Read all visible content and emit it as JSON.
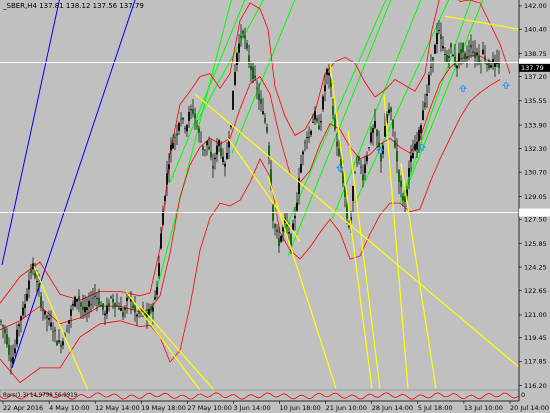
{
  "window": {
    "title": "_SBER,H4  137.81 138.12 137.56 137.79"
  },
  "indicator": {
    "label": "Bars(1,3) 14.9798 56.9919"
  },
  "colors": {
    "background": "#c0c0c0",
    "up_body": "#000000",
    "down_body": "#006400",
    "wick": "#000000",
    "bands": "#ff0000",
    "trend_yellow": "#ffff00",
    "trend_green": "#00ff00",
    "trend_blue": "#0000ff",
    "hline": "#ffffff",
    "arrow": "#1e90ff"
  },
  "chart_data": {
    "type": "candlestick",
    "symbol": "_SBER",
    "timeframe": "H4",
    "ohlc_header": {
      "open": 137.81,
      "high": 138.12,
      "low": 137.56,
      "close": 137.79
    },
    "y_ticks": [
      142.0,
      140.4,
      138.75,
      137.2,
      135.55,
      133.9,
      132.3,
      130.7,
      129.05,
      127.5,
      125.85,
      124.25,
      122.65,
      121.0,
      119.45,
      117.85,
      116.2
    ],
    "y_range": [
      115.9,
      142.4
    ],
    "x_ticks": [
      "22 Apr 2016",
      "4 May 10:00",
      "12 May 14:00",
      "19 May 18:00",
      "27 May 10:00",
      "3 Jun 14:00",
      "10 Jun 18:00",
      "21 Jun 10:00",
      "28 Jun 14:00",
      "5 Jul 18:00",
      "13 Jul 10:00",
      "20 Jul 14:00"
    ],
    "current_price_badge": "137.79",
    "hline_badges": [
      "138.15",
      "127.96"
    ],
    "bottom_badge": "0",
    "horizontal_lines": [
      138.15,
      127.96
    ],
    "price_path": [
      [
        0,
        120.6
      ],
      [
        3,
        120.2
      ],
      [
        6,
        119.6
      ],
      [
        9,
        118.5
      ],
      [
        12,
        117.9
      ],
      [
        15,
        118.7
      ],
      [
        18,
        120.2
      ],
      [
        21,
        121.0
      ],
      [
        24,
        121.4
      ],
      [
        27,
        122.6
      ],
      [
        30,
        123.8
      ],
      [
        33,
        124.3
      ],
      [
        36,
        123.4
      ],
      [
        39,
        122.6
      ],
      [
        42,
        121.5
      ],
      [
        45,
        121.0
      ],
      [
        48,
        120.7
      ],
      [
        51,
        120.3
      ],
      [
        54,
        119.9
      ],
      [
        57,
        119.2
      ],
      [
        60,
        119.0
      ],
      [
        63,
        119.3
      ],
      [
        66,
        119.9
      ],
      [
        69,
        120.7
      ],
      [
        72,
        121.5
      ],
      [
        75,
        122.0
      ],
      [
        78,
        122.3
      ],
      [
        81,
        121.6
      ],
      [
        84,
        121.2
      ],
      [
        87,
        121.4
      ],
      [
        90,
        121.8
      ],
      [
        93,
        122.2
      ],
      [
        96,
        122.4
      ],
      [
        99,
        121.9
      ],
      [
        102,
        121.5
      ],
      [
        105,
        121.0
      ],
      [
        108,
        121.6
      ],
      [
        111,
        122.2
      ],
      [
        114,
        121.9
      ],
      [
        117,
        121.6
      ],
      [
        120,
        121.5
      ],
      [
        123,
        121.0
      ],
      [
        126,
        121.7
      ],
      [
        129,
        122.3
      ],
      [
        132,
        121.8
      ],
      [
        135,
        121.1
      ],
      [
        138,
        120.9
      ],
      [
        141,
        121.3
      ],
      [
        144,
        121.1
      ],
      [
        147,
        120.9
      ],
      [
        150,
        121.3
      ],
      [
        153,
        121.6
      ],
      [
        156,
        122.4
      ],
      [
        159,
        124.5
      ],
      [
        162,
        127.4
      ],
      [
        165,
        129.3
      ],
      [
        168,
        131.1
      ],
      [
        171,
        132.4
      ],
      [
        174,
        133.0
      ],
      [
        177,
        133.4
      ],
      [
        180,
        134.6
      ],
      [
        183,
        134.1
      ],
      [
        186,
        133.7
      ],
      [
        189,
        134.6
      ],
      [
        192,
        135.0
      ],
      [
        195,
        134.4
      ],
      [
        198,
        133.5
      ],
      [
        201,
        132.8
      ],
      [
        204,
        132.1
      ],
      [
        207,
        132.8
      ],
      [
        210,
        131.8
      ],
      [
        213,
        131.0
      ],
      [
        216,
        132.1
      ],
      [
        219,
        132.8
      ],
      [
        222,
        131.7
      ],
      [
        225,
        131.0
      ],
      [
        228,
        132.6
      ],
      [
        231,
        134.2
      ],
      [
        234,
        136.8
      ],
      [
        237,
        138.8
      ],
      [
        240,
        139.7
      ],
      [
        243,
        140.4
      ],
      [
        246,
        139.2
      ],
      [
        249,
        138.2
      ],
      [
        252,
        137.6
      ],
      [
        255,
        136.8
      ],
      [
        258,
        136.0
      ],
      [
        261,
        135.2
      ],
      [
        264,
        134.4
      ],
      [
        267,
        133.6
      ],
      [
        270,
        131.0
      ],
      [
        273,
        127.6
      ],
      [
        276,
        126.6
      ],
      [
        279,
        125.9
      ],
      [
        282,
        126.6
      ],
      [
        285,
        127.4
      ],
      [
        288,
        126.6
      ],
      [
        291,
        126.0
      ],
      [
        294,
        127.4
      ],
      [
        297,
        128.8
      ],
      [
        300,
        130.7
      ],
      [
        303,
        132.3
      ],
      [
        306,
        133.3
      ],
      [
        309,
        133.0
      ],
      [
        312,
        134.1
      ],
      [
        315,
        134.6
      ],
      [
        318,
        133.6
      ],
      [
        321,
        134.4
      ],
      [
        324,
        136.2
      ],
      [
        327,
        137.6
      ],
      [
        330,
        137.0
      ],
      [
        333,
        134.7
      ],
      [
        336,
        133.0
      ],
      [
        339,
        131.7
      ],
      [
        342,
        130.7
      ],
      [
        345,
        129.0
      ],
      [
        348,
        126.9
      ],
      [
        351,
        127.7
      ],
      [
        354,
        130.4
      ],
      [
        357,
        131.6
      ],
      [
        360,
        131.2
      ],
      [
        363,
        130.4
      ],
      [
        366,
        131.6
      ],
      [
        369,
        132.6
      ],
      [
        372,
        133.4
      ],
      [
        375,
        133.9
      ],
      [
        378,
        132.6
      ],
      [
        381,
        131.6
      ],
      [
        384,
        133.1
      ],
      [
        387,
        134.6
      ],
      [
        390,
        135.0
      ],
      [
        393,
        133.6
      ],
      [
        396,
        132.0
      ],
      [
        399,
        130.3
      ],
      [
        402,
        129.1
      ],
      [
        405,
        128.6
      ],
      [
        408,
        130.4
      ],
      [
        411,
        131.6
      ],
      [
        414,
        132.2
      ],
      [
        417,
        132.7
      ],
      [
        420,
        133.6
      ],
      [
        423,
        135.0
      ],
      [
        426,
        135.6
      ],
      [
        429,
        137.1
      ],
      [
        432,
        138.3
      ],
      [
        435,
        139.2
      ],
      [
        438,
        140.4
      ],
      [
        441,
        139.6
      ],
      [
        444,
        138.9
      ],
      [
        447,
        138.2
      ],
      [
        450,
        139.2
      ],
      [
        453,
        138.6
      ],
      [
        456,
        137.9
      ],
      [
        459,
        138.6
      ],
      [
        462,
        139.2
      ],
      [
        465,
        138.2
      ],
      [
        468,
        138.9
      ],
      [
        471,
        139.4
      ],
      [
        474,
        138.6
      ],
      [
        477,
        138.8
      ],
      [
        480,
        138.2
      ],
      [
        483,
        138.9
      ],
      [
        486,
        138.3
      ],
      [
        489,
        137.9
      ],
      [
        492,
        138.3
      ],
      [
        495,
        137.9
      ],
      [
        498,
        138.0
      ],
      [
        500,
        137.9
      ]
    ],
    "bollinger_upper": [
      [
        0,
        121.8
      ],
      [
        20,
        123.6
      ],
      [
        40,
        124.6
      ],
      [
        60,
        122.4
      ],
      [
        80,
        122.0
      ],
      [
        100,
        122.6
      ],
      [
        120,
        122.6
      ],
      [
        140,
        122.3
      ],
      [
        150,
        122.5
      ],
      [
        160,
        125.5
      ],
      [
        170,
        132.0
      ],
      [
        180,
        135.3
      ],
      [
        190,
        136.2
      ],
      [
        200,
        137.2
      ],
      [
        210,
        137.4
      ],
      [
        220,
        136.4
      ],
      [
        230,
        137.4
      ],
      [
        240,
        141.0
      ],
      [
        250,
        142.2
      ],
      [
        260,
        141.8
      ],
      [
        268,
        140.4
      ],
      [
        275,
        136.5
      ],
      [
        285,
        134.5
      ],
      [
        295,
        133.2
      ],
      [
        305,
        133.6
      ],
      [
        315,
        134.8
      ],
      [
        325,
        137.4
      ],
      [
        335,
        138.2
      ],
      [
        345,
        138.5
      ],
      [
        355,
        138.1
      ],
      [
        365,
        136.8
      ],
      [
        375,
        135.8
      ],
      [
        385,
        136.3
      ],
      [
        395,
        137.0
      ],
      [
        405,
        136.6
      ],
      [
        415,
        136.2
      ],
      [
        425,
        137.4
      ],
      [
        432,
        140.4
      ],
      [
        440,
        142.6
      ],
      [
        450,
        143.0
      ],
      [
        460,
        142.3
      ],
      [
        470,
        142.4
      ],
      [
        480,
        142.2
      ],
      [
        490,
        140.8
      ],
      [
        500,
        139.4
      ],
      [
        510,
        137.4
      ]
    ],
    "bollinger_middle": [
      [
        0,
        120.0
      ],
      [
        20,
        120.6
      ],
      [
        40,
        121.6
      ],
      [
        60,
        120.4
      ],
      [
        80,
        120.8
      ],
      [
        100,
        121.6
      ],
      [
        120,
        121.6
      ],
      [
        140,
        121.2
      ],
      [
        150,
        121.4
      ],
      [
        160,
        122.3
      ],
      [
        170,
        125.2
      ],
      [
        180,
        129.0
      ],
      [
        190,
        131.2
      ],
      [
        200,
        132.4
      ],
      [
        210,
        133.0
      ],
      [
        220,
        132.6
      ],
      [
        230,
        133.0
      ],
      [
        240,
        135.0
      ],
      [
        250,
        136.7
      ],
      [
        260,
        137.2
      ],
      [
        270,
        136.0
      ],
      [
        280,
        133.0
      ],
      [
        290,
        130.6
      ],
      [
        300,
        130.0
      ],
      [
        310,
        130.8
      ],
      [
        320,
        132.6
      ],
      [
        330,
        134.0
      ],
      [
        340,
        133.6
      ],
      [
        350,
        132.4
      ],
      [
        360,
        131.6
      ],
      [
        370,
        131.9
      ],
      [
        380,
        132.6
      ],
      [
        390,
        133.0
      ],
      [
        400,
        132.4
      ],
      [
        410,
        132.0
      ],
      [
        420,
        133.0
      ],
      [
        430,
        135.0
      ],
      [
        440,
        136.8
      ],
      [
        450,
        137.8
      ],
      [
        460,
        138.4
      ],
      [
        470,
        138.6
      ],
      [
        480,
        138.6
      ],
      [
        490,
        138.2
      ],
      [
        500,
        138.1
      ]
    ],
    "bollinger_lower": [
      [
        0,
        118.0
      ],
      [
        20,
        116.4
      ],
      [
        40,
        117.4
      ],
      [
        60,
        117.4
      ],
      [
        80,
        119.5
      ],
      [
        100,
        120.4
      ],
      [
        120,
        120.6
      ],
      [
        140,
        120.2
      ],
      [
        150,
        120.3
      ],
      [
        160,
        119.5
      ],
      [
        170,
        117.8
      ],
      [
        180,
        118.6
      ],
      [
        190,
        121.6
      ],
      [
        200,
        125.4
      ],
      [
        210,
        127.6
      ],
      [
        220,
        128.6
      ],
      [
        230,
        128.4
      ],
      [
        240,
        128.8
      ],
      [
        250,
        130.0
      ],
      [
        260,
        131.6
      ],
      [
        270,
        130.4
      ],
      [
        280,
        126.6
      ],
      [
        290,
        125.4
      ],
      [
        300,
        124.8
      ],
      [
        310,
        125.6
      ],
      [
        320,
        126.6
      ],
      [
        330,
        127.5
      ],
      [
        340,
        126.6
      ],
      [
        350,
        124.8
      ],
      [
        360,
        125.0
      ],
      [
        370,
        126.5
      ],
      [
        380,
        127.8
      ],
      [
        390,
        128.6
      ],
      [
        400,
        128.6
      ],
      [
        410,
        128.0
      ],
      [
        420,
        128.2
      ],
      [
        430,
        130.0
      ],
      [
        440,
        131.6
      ],
      [
        450,
        133.0
      ],
      [
        460,
        134.4
      ],
      [
        470,
        135.5
      ],
      [
        480,
        136.1
      ],
      [
        490,
        136.6
      ],
      [
        500,
        137.0
      ]
    ],
    "yellow_lines": [
      [
        [
          34,
          124.3
        ],
        [
          88,
          115.9
        ]
      ],
      [
        [
          126,
          122.6
        ],
        [
          200,
          115.9
        ]
      ],
      [
        [
          140,
          121.6
        ],
        [
          245,
          113.5
        ]
      ],
      [
        [
          195,
          136.0
        ],
        [
          520,
          117.4
        ]
      ],
      [
        [
          228,
          133.0
        ],
        [
          300,
          126.0
        ]
      ],
      [
        [
          268,
          130.4
        ],
        [
          336,
          116.0
        ]
      ],
      [
        [
          330,
          138.0
        ],
        [
          372,
          116.0
        ]
      ],
      [
        [
          348,
          133.5
        ],
        [
          380,
          116.0
        ]
      ],
      [
        [
          384,
          136.0
        ],
        [
          408,
          116.0
        ]
      ],
      [
        [
          401,
          131.3
        ],
        [
          436,
          116.0
        ]
      ],
      [
        [
          445,
          141.3
        ],
        [
          520,
          140.4
        ]
      ]
    ],
    "green_lines": [
      [
        [
          148,
          120.4
        ],
        [
          232,
          142.6
        ]
      ],
      [
        [
          170,
          130.0
        ],
        [
          246,
          142.6
        ]
      ],
      [
        [
          196,
          134.0
        ],
        [
          265,
          142.6
        ]
      ],
      [
        [
          232,
          132.0
        ],
        [
          296,
          142.6
        ]
      ],
      [
        [
          280,
          126.0
        ],
        [
          387,
          142.6
        ]
      ],
      [
        [
          288,
          125.0
        ],
        [
          392,
          142.6
        ]
      ],
      [
        [
          332,
          127.5
        ],
        [
          422,
          142.6
        ]
      ],
      [
        [
          355,
          128.6
        ],
        [
          450,
          142.6
        ]
      ],
      [
        [
          400,
          128.6
        ],
        [
          472,
          142.6
        ]
      ],
      [
        [
          404,
          129.2
        ],
        [
          484,
          142.6
        ]
      ]
    ],
    "blue_lines": [
      [
        [
          2,
          124.4
        ],
        [
          60,
          142.6
        ]
      ],
      [
        [
          12,
          117.4
        ],
        [
          136,
          142.6
        ]
      ]
    ],
    "up_arrows": [
      [
        340,
        131.0
      ],
      [
        380,
        132.2
      ],
      [
        422,
        132.4
      ],
      [
        463,
        136.4
      ],
      [
        506,
        136.6
      ]
    ]
  }
}
